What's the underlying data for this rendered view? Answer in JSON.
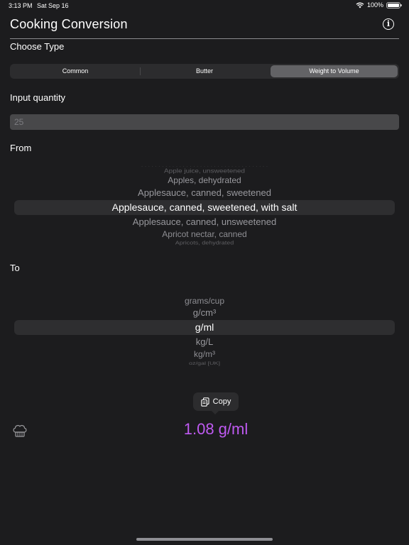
{
  "status_bar": {
    "time": "3:13 PM",
    "date": "Sat Sep 16",
    "battery": "100%"
  },
  "app": {
    "title": "Cooking Conversion"
  },
  "choose_type": {
    "label": "Choose Type",
    "segments": [
      "Common",
      "Butter",
      "Weight to Volume"
    ],
    "selected": "Weight to Volume"
  },
  "input_quantity": {
    "label": "Input quantity",
    "placeholder": "25"
  },
  "from_picker": {
    "label": "From",
    "items": [
      "Apple juice, unsweetened",
      "Apples, dehydrated",
      "Applesauce, canned, sweetened",
      "Applesauce, canned, sweetened, with salt",
      "Applesauce, canned, unsweetened",
      "Apricot nectar, canned",
      "Apricots, dehydrated"
    ],
    "selected": "Applesauce, canned, sweetened, with salt"
  },
  "to_picker": {
    "label": "To",
    "items": [
      "grams/cup",
      "g/cm³",
      "g/ml",
      "kg/L",
      "kg/m³",
      "oz/gal [UK]"
    ],
    "selected": "g/ml"
  },
  "copy_button": {
    "label": "Copy"
  },
  "result": {
    "text": "1.08 g/ml"
  },
  "colors": {
    "background": "#1c1c1e",
    "result": "#bf5af2",
    "segment_active": "#636366"
  },
  "icons": [
    "wifi-icon",
    "battery-icon",
    "info-icon",
    "copy-icon",
    "chef-hat-icon"
  ]
}
